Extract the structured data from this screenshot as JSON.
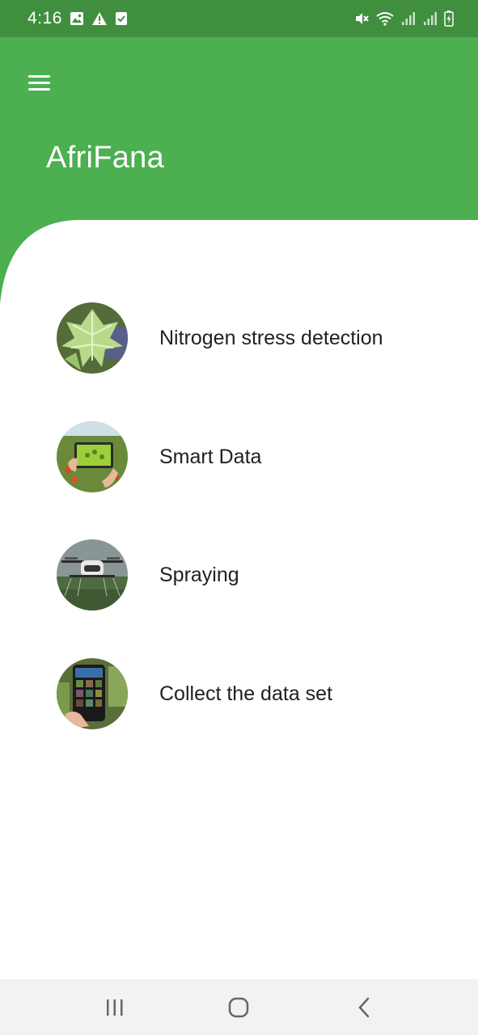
{
  "status_bar": {
    "time": "4:16",
    "left_icons": [
      "image-icon",
      "warning-icon",
      "checkbox-icon"
    ],
    "right_icons": [
      "mute-icon",
      "wifi-icon",
      "signal-icon",
      "signal-icon",
      "battery-charging-icon"
    ]
  },
  "header": {
    "title": "AfriFana",
    "menu_icon": "hamburger-menu-icon"
  },
  "colors": {
    "status_bar": "#3f8f3f",
    "header": "#4caf50",
    "background": "#ffffff",
    "text": "#212121",
    "nav_bar": "#f2f2f2"
  },
  "menu": {
    "items": [
      {
        "label": "Nitrogen stress detection",
        "image": "leaf-photo"
      },
      {
        "label": "Smart Data",
        "image": "tablet-in-field-photo"
      },
      {
        "label": "Spraying",
        "image": "drone-photo"
      },
      {
        "label": "Collect the data set",
        "image": "phone-app-photo"
      }
    ]
  },
  "nav_bar": {
    "buttons": [
      "recent-apps-icon",
      "home-icon",
      "back-icon"
    ]
  }
}
